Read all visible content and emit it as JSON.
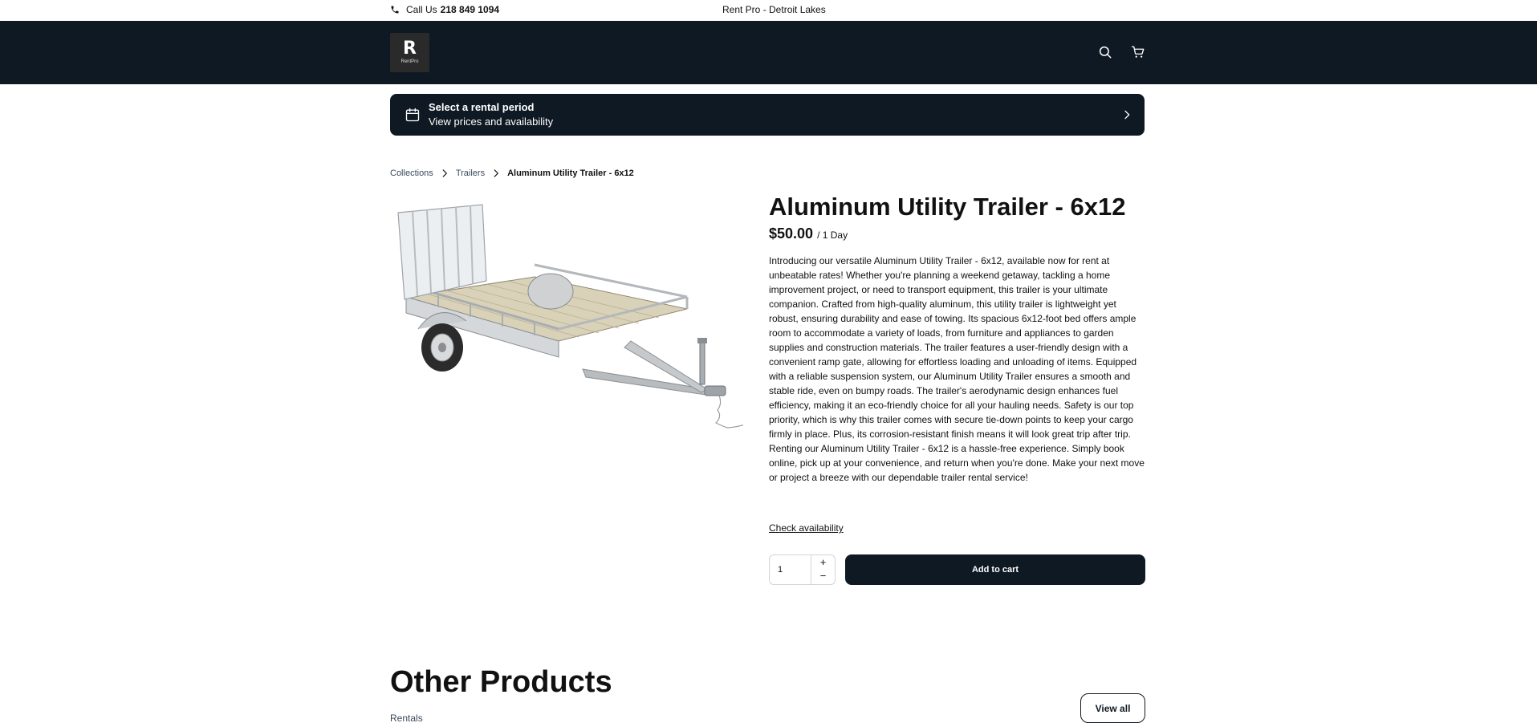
{
  "topbar": {
    "call_prefix": "Call Us",
    "phone": "218 849 1094",
    "store_name": "Rent Pro - Detroit Lakes"
  },
  "header": {
    "logo_mark": "R",
    "logo_text": "RentPro",
    "icons": [
      "search-icon",
      "cart-icon"
    ]
  },
  "rental_banner": {
    "title": "Select a rental period",
    "subtitle": "View prices and availability"
  },
  "breadcrumb": {
    "items": [
      "Collections",
      "Trailers"
    ],
    "current": "Aluminum Utility Trailer - 6x12"
  },
  "product": {
    "title": "Aluminum Utility Trailer - 6x12",
    "price": "$50.00",
    "price_period": "/ 1 Day",
    "description": "Introducing our versatile Aluminum Utility Trailer - 6x12, available now for rent at unbeatable rates! Whether you're planning a weekend getaway, tackling a home improvement project, or need to transport equipment, this trailer is your ultimate companion. Crafted from high-quality aluminum, this utility trailer is lightweight yet robust, ensuring durability and ease of towing. Its spacious 6x12-foot bed offers ample room to accommodate a variety of loads, from furniture and appliances to garden supplies and construction materials. The trailer features a user-friendly design with a convenient ramp gate, allowing for effortless loading and unloading of items. Equipped with a reliable suspension system, our Aluminum Utility Trailer ensures a smooth and stable ride, even on bumpy roads. The trailer's aerodynamic design enhances fuel efficiency, making it an eco-friendly choice for all your hauling needs. Safety is our top priority, which is why this trailer comes with secure tie-down points to keep your cargo firmly in place. Plus, its corrosion-resistant finish means it will look great trip after trip. Renting our Aluminum Utility Trailer - 6x12 is a hassle-free experience. Simply book online, pick up at your convenience, and return when you're done. Make your next move or project a breeze with our dependable trailer rental service!",
    "check_availability": "Check availability",
    "quantity": "1",
    "qty_plus": "+",
    "qty_minus": "−",
    "add_to_cart": "Add to cart"
  },
  "other_products": {
    "heading": "Other Products",
    "category": "Rentals",
    "view_all": "View all"
  },
  "colors": {
    "header_bg": "#0f1923",
    "link": "#3b4a5a"
  }
}
